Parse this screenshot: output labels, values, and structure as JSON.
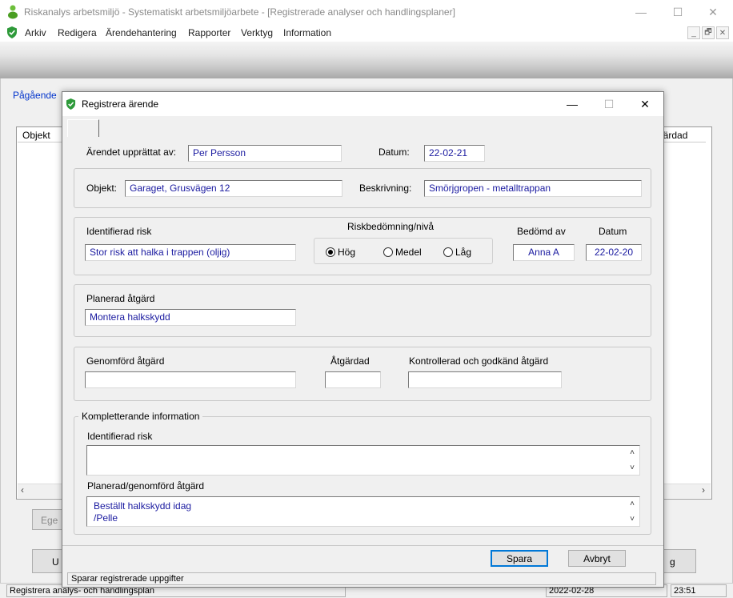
{
  "main_window": {
    "title": "Riskanalys arbetsmiljö - Systematiskt arbetsmiljöarbete - [Registrerade analyser och handlingsplaner]",
    "controls": {
      "minimize": "—",
      "maximize": "☐",
      "close": "✕"
    },
    "menu": [
      "Arkiv",
      "Redigera",
      "Ärendehantering",
      "Rapporter",
      "Verktyg",
      "Information"
    ],
    "mdi_controls": [
      "_",
      "🗗",
      "✕"
    ]
  },
  "background": {
    "tab_label": "Pågående",
    "list_columns": {
      "left": "Objekt",
      "right": "gärdad"
    },
    "button_left_top": "Ege",
    "button_left_bottom": "U",
    "button_right_bottom": "g",
    "status": {
      "left": "Registrera analys- och handlingsplan",
      "date": "2022-02-28",
      "time": "23:51"
    }
  },
  "dialog": {
    "title": "Registrera ärende",
    "controls": {
      "minimize": "—",
      "maximize": "☐",
      "close": "✕"
    },
    "header": {
      "upprattat_label": "Ärendet upprättat av:",
      "upprattat_value": "Per Persson",
      "datum_label": "Datum:",
      "datum_value": "22-02-21"
    },
    "objekt": {
      "label": "Objekt:",
      "value": "Garaget, Grusvägen 12",
      "beskrivning_label": "Beskrivning:",
      "beskrivning_value": "Smörjgropen - metalltrappan"
    },
    "risk": {
      "identifierad_label": "Identifierad risk",
      "identifierad_value": "Stor risk att halka i trappen (oljig)",
      "bedomning_label": "Riskbedömning/nivå",
      "options": [
        {
          "label": "Hög",
          "selected": true
        },
        {
          "label": "Medel",
          "selected": false
        },
        {
          "label": "Låg",
          "selected": false
        }
      ],
      "bedomd_av_label": "Bedömd av",
      "bedomd_av_value": "Anna A",
      "datum_label": "Datum",
      "datum_value": "22-02-20"
    },
    "planerad": {
      "label": "Planerad åtgärd",
      "value": "Montera halkskydd"
    },
    "genomford": {
      "label": "Genomförd åtgärd",
      "value": "",
      "atgardad_label": "Åtgärdad",
      "atgardad_value": "",
      "kontrollerad_label": "Kontrollerad och godkänd åtgärd",
      "kontrollerad_value": ""
    },
    "kompletterande": {
      "legend": "Kompletterande information",
      "identifierad_label": "Identifierad risk",
      "identifierad_value": "",
      "planerad_label": "Planerad/genomförd åtgärd",
      "planerad_lines": [
        "Beställt halkskydd idag",
        "/Pelle"
      ]
    },
    "buttons": {
      "save": "Spara",
      "cancel": "Avbryt"
    },
    "status": "Sparar registrerade uppgifter"
  }
}
